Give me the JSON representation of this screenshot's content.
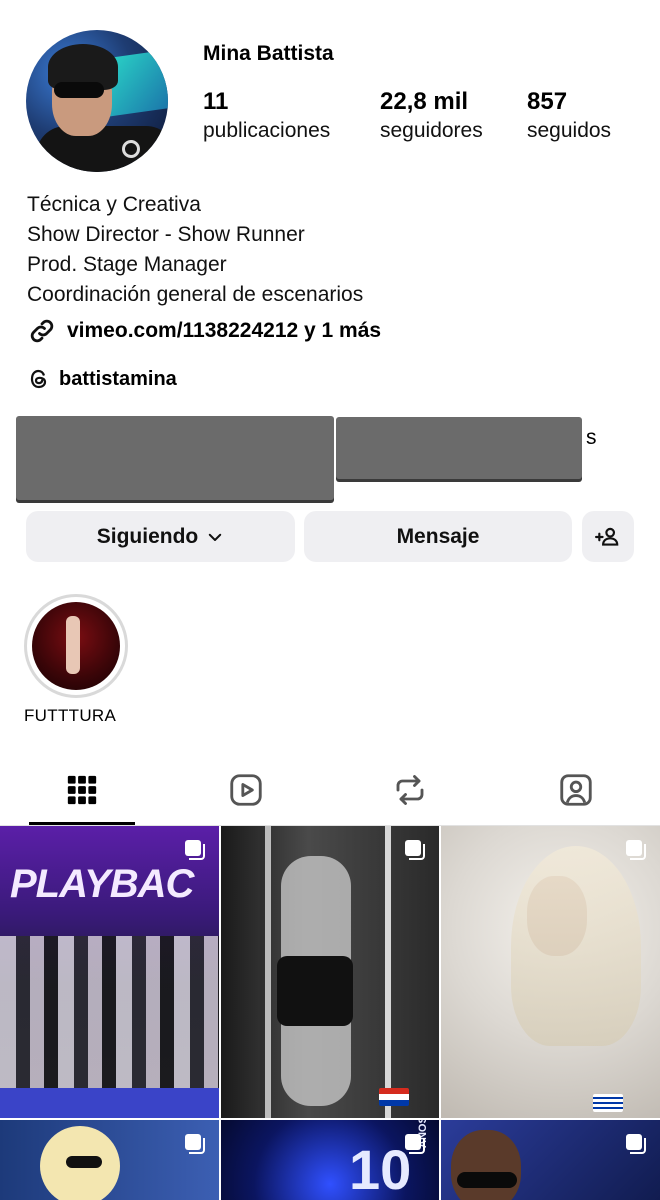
{
  "profile": {
    "name": "Mina Battista",
    "stats": [
      {
        "value": "11",
        "label": "publicaciones"
      },
      {
        "value": "22,8 mil",
        "label": "seguidores"
      },
      {
        "value": "857",
        "label": "seguidos"
      }
    ],
    "bio": [
      "Técnica y Creativa",
      "Show Director - Show Runner",
      "Prod. Stage Manager",
      "Coordinación general de escenarios"
    ],
    "link": "vimeo.com/1138224212 y 1 más",
    "threads": "battistamina",
    "redacted_tail": "s"
  },
  "buttons": {
    "following": "Siguiendo",
    "message": "Mensaje"
  },
  "highlight": {
    "label": "FUTTTURA"
  },
  "tabs": [
    "grid-icon",
    "reels-icon",
    "reposts-icon",
    "tagged-icon"
  ],
  "posts": [
    {
      "caption": "PLAYBAC",
      "kind": "group"
    },
    {
      "kind": "bw-pole",
      "flag": "paraguay"
    },
    {
      "kind": "fur",
      "flag": "uruguay"
    },
    {
      "kind": "blonde"
    },
    {
      "caption": "10",
      "sub": "AÑOS",
      "kind": "stage"
    },
    {
      "kind": "portrait"
    }
  ],
  "colors": {
    "button_bg": "#efeff2",
    "redact": "#6b6b6b"
  }
}
